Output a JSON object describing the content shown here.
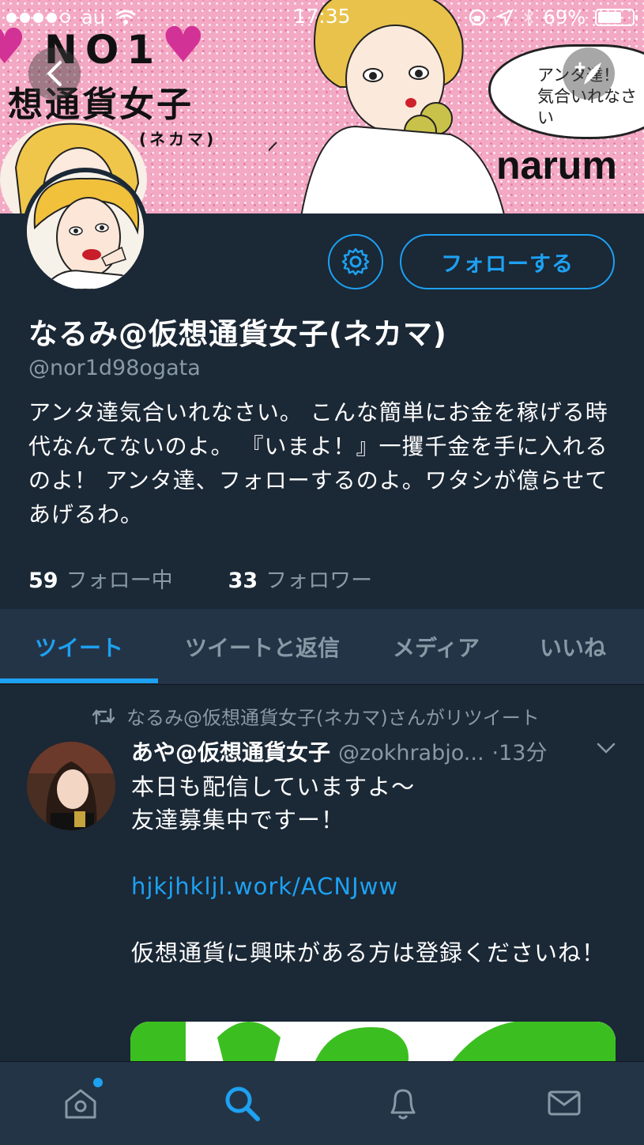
{
  "status_bar": {
    "carrier": "au",
    "time": "17:35",
    "battery_percent": "69%",
    "battery_level": 0.69
  },
  "banner": {
    "title_line1": "NO1",
    "title_line2": "想通貨女子",
    "title_line3": "(ネカマ)",
    "brand": "narum",
    "speech_line1": "アンタ達！",
    "speech_line2": "気合いれなさい"
  },
  "profile": {
    "display_name": "なるみ@仮想通貨女子(ネカマ)",
    "handle": "@nor1d98ogata",
    "bio": "アンタ達気合いれなさい。 こんな簡単にお金を稼げる時代なんてないのよ。 『いまよ！』一攫千金を手に入れるのよ！ アンタ達、フォローするのよ。ワタシが億らせてあげるわ。",
    "follow_label": "フォローする",
    "following_count": "59",
    "following_label": "フォロー中",
    "followers_count": "33",
    "followers_label": "フォロワー"
  },
  "tabs": [
    {
      "label": "ツイート",
      "active": true
    },
    {
      "label": "ツイートと返信",
      "active": false
    },
    {
      "label": "メディア",
      "active": false
    },
    {
      "label": "いいね",
      "active": false
    }
  ],
  "tweet": {
    "retweet_note": "なるみ@仮想通貨女子(ネカマ)さんがリツイート",
    "author_name": "あや@仮想通貨女子",
    "author_handle": "@zokhrabjo...",
    "time": "·13分",
    "line1": "本日も配信していますよ〜",
    "line2": "友達募集中ですー！",
    "link": "hjkjhkljl.work/ACNJww",
    "line3": "仮想通貨に興味がある方は登録くださいね！"
  },
  "colors": {
    "background": "#1b2836",
    "bar": "#243447",
    "accent": "#1da1f2",
    "muted": "#8899a6"
  },
  "icons": [
    "back-icon",
    "compose-icon",
    "gear-icon",
    "retweet-icon",
    "chevron-down-icon",
    "home-icon",
    "search-icon",
    "bell-icon",
    "mail-icon",
    "wifi-icon",
    "lock-rotation-icon",
    "location-icon",
    "bluetooth-icon",
    "battery-icon"
  ]
}
